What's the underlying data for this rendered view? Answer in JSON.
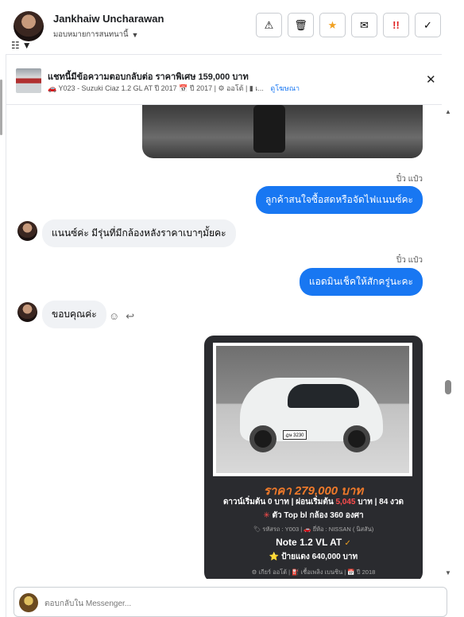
{
  "header": {
    "name": "Jankhaiw Uncharawan",
    "assign": "มอบหมายการสนทนานี้",
    "actions": [
      {
        "icon": "warning-icon",
        "glyph": "⚠"
      },
      {
        "icon": "trash-icon",
        "glyph": "🗑"
      },
      {
        "icon": "star-icon",
        "glyph": "★"
      },
      {
        "icon": "mail-icon",
        "glyph": "✉"
      },
      {
        "icon": "urgent-icon",
        "glyph": "!!"
      },
      {
        "icon": "check-icon",
        "glyph": "✓"
      }
    ]
  },
  "context": {
    "title": "แชทนี้มีข้อความตอบกลับต่อ ราคาพิเศษ 159,000 บาท",
    "subtitle": "🚗 Y023 - Suzuki Ciaz 1.2 GL AT ปี 2017 📅 ปี 2017 | ⚙ ออโต้ | ▮ เ...",
    "link": "ดูโฆษณา"
  },
  "messages": {
    "sender1": "ปิ๋ว แป๋ว",
    "out1": "ลูกค้าสนใจซื้อสดหรือจัดไฟแนนซ์คะ",
    "in1": "แนนซ์ค่ะ มีรุ่นที่มีกล้องหลังราคาเบาๆมั้ยคะ",
    "sender2": "ปิ๋ว แป๋ว",
    "out2": "แอดมินเช็คให้สักครู่นะคะ",
    "in2": "ขอบคุณค่ะ"
  },
  "card": {
    "plate": "ฎษ 3230",
    "price": "ราคา 279,000 บาท",
    "terms_a": "ดาวน์เริ่มต้น 0 บาท | ผ่อนเริ่มต้น ",
    "terms_red": "5,045",
    "terms_b": " บาท | 84 งวด",
    "feature_icon": "✳",
    "feature": " ตัว Top bl กล้อง 360 องศา",
    "meta": "🏷 รหัสรถ : Y003 | 🚗 ยี่ห้อ : NISSAN ( นิสสัน)",
    "model": "Note 1.2 VL AT ",
    "verified": "✓",
    "plate_line": "⭐ ป้ายแดง 640,000 บาท",
    "footer": "⚙ เกียร์ ออโต้ | ⛽ เชื้อเพลิง เบนซิน | 📅 ปี 2018"
  },
  "composer": {
    "placeholder": "ตอบกลับใน Messenger..."
  }
}
